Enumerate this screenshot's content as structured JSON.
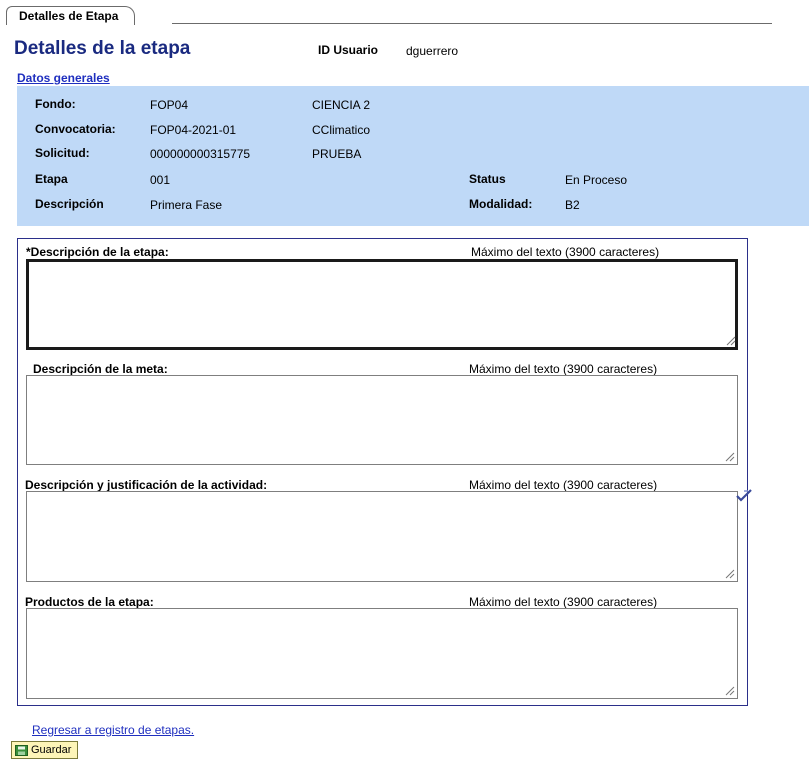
{
  "tab": {
    "label": "Detalles de Etapa"
  },
  "header": {
    "title": "Detalles de la etapa",
    "user_id_label": "ID Usuario",
    "user_id_value": "dguerrero"
  },
  "general": {
    "section_link": "Datos generales",
    "fondo_label": "Fondo:",
    "fondo_value": "FOP04",
    "fondo_name": "CIENCIA 2",
    "convocatoria_label": "Convocatoria:",
    "convocatoria_value": "FOP04-2021-01",
    "convocatoria_name": "CClimatico",
    "solicitud_label": "Solicitud:",
    "solicitud_value": "000000000315775",
    "solicitud_name": "PRUEBA",
    "etapa_label": "Etapa",
    "etapa_value": "001",
    "status_label": "Status",
    "status_value": "En Proceso",
    "descripcion_label": "Descripción",
    "descripcion_value": "Primera Fase",
    "modalidad_label": "Modalidad:",
    "modalidad_value": "B2"
  },
  "fields": {
    "max_note": "Máximo del texto (3900 caracteres)",
    "etapa_desc_label": "*Descripción de la etapa:",
    "etapa_desc_value": "",
    "meta_label": "Descripción de la meta:",
    "meta_value": "",
    "actividad_label": "Descripción y justificación de la actividad:",
    "actividad_value": "",
    "productos_label": "Productos de la etapa:",
    "productos_value": ""
  },
  "footer": {
    "back_link": "Regresar a registro de etapas.",
    "save_label": "Guardar"
  },
  "colors": {
    "title": "#1a2a80",
    "panel": "#bfd9f7",
    "link": "#1f2fbf",
    "button": "#fdf5b8"
  }
}
